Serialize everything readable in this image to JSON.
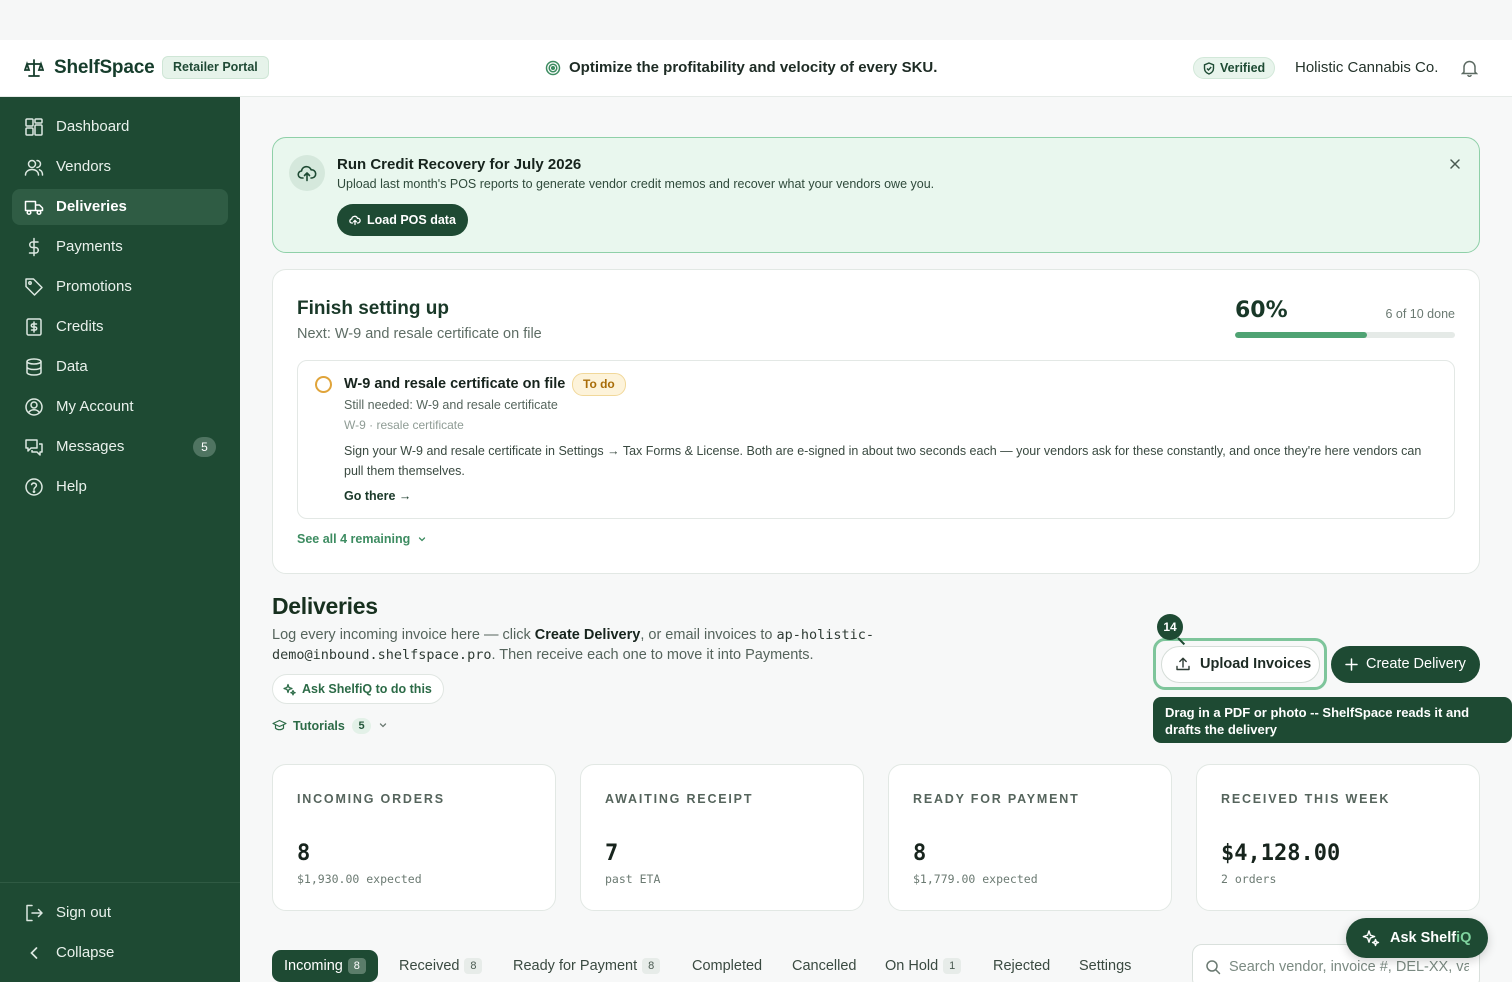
{
  "header": {
    "brand": "ShelfSpace",
    "portal_badge": "Retailer Portal",
    "tagline": "Optimize the profitability and velocity of every SKU.",
    "verified": "Verified",
    "company": "Holistic Cannabis Co."
  },
  "sidebar": {
    "items": [
      {
        "label": "Dashboard",
        "icon": "dashboard-icon"
      },
      {
        "label": "Vendors",
        "icon": "users-icon"
      },
      {
        "label": "Deliveries",
        "icon": "truck-icon",
        "active": true
      },
      {
        "label": "Payments",
        "icon": "dollar-icon"
      },
      {
        "label": "Promotions",
        "icon": "tag-icon"
      },
      {
        "label": "Credits",
        "icon": "receipt-icon"
      },
      {
        "label": "Data",
        "icon": "database-icon"
      },
      {
        "label": "My Account",
        "icon": "user-circle-icon"
      },
      {
        "label": "Messages",
        "icon": "messages-icon",
        "badge": "5"
      },
      {
        "label": "Help",
        "icon": "help-icon"
      }
    ],
    "sign_out": "Sign out",
    "collapse": "Collapse"
  },
  "promo": {
    "title": "Run Credit Recovery for July 2026",
    "subtitle": "Upload last month's POS reports to generate vendor credit memos and recover what your vendors owe you.",
    "button": "Load POS data"
  },
  "setup": {
    "title": "Finish setting up",
    "next": "Next: W-9 and resale certificate on file",
    "percent_label": "60%",
    "progress": 0.6,
    "count": "6 of 10 done",
    "task": {
      "title": "W-9 and resale certificate on file",
      "status": "To do",
      "needed": "Still needed: W-9 and resale certificate",
      "tags": "W-9 · resale certificate",
      "description": "Sign your W-9 and resale certificate in Settings → Tax Forms & License. Both are e-signed in about two seconds each — your vendors ask for these constantly, and once they're here vendors can pull them themselves.",
      "link": "Go there →"
    },
    "see_all": "See all 4 remaining"
  },
  "deliveries": {
    "title": "Deliveries",
    "desc_pre": "Log every incoming invoice here — click ",
    "desc_bold": "Create Delivery",
    "desc_mid": ", or email invoices to ",
    "desc_email": "ap-holistic-demo@inbound.shelfspace.pro",
    "desc_post": ". Then receive each one to move it into Payments.",
    "ask_button": "Ask ShelfiQ to do this",
    "tutorials_label": "Tutorials",
    "tutorials_count": "5",
    "step_number": "14",
    "upload_button": "Upload Invoices",
    "create_button": "Create Delivery",
    "tooltip": "Drag in a PDF or photo -- ShelfSpace reads it and drafts the delivery"
  },
  "stats": [
    {
      "label": "INCOMING ORDERS",
      "value": "8",
      "sub": "$1,930.00 expected"
    },
    {
      "label": "AWAITING RECEIPT",
      "value": "7",
      "sub": "past ETA"
    },
    {
      "label": "READY FOR PAYMENT",
      "value": "8",
      "sub": "$1,779.00 expected"
    },
    {
      "label": "RECEIVED THIS WEEK",
      "value": "$4,128.00",
      "sub": "2 orders"
    }
  ],
  "tabs": [
    {
      "label": "Incoming",
      "count": "8",
      "active": true
    },
    {
      "label": "Received",
      "count": "8"
    },
    {
      "label": "Ready for Payment",
      "count": "8"
    },
    {
      "label": "Completed"
    },
    {
      "label": "Cancelled"
    },
    {
      "label": "On Hold",
      "count": "1"
    },
    {
      "label": "Rejected"
    },
    {
      "label": "Settings"
    }
  ],
  "search": {
    "placeholder": "Search vendor, invoice #, DEL-XX, va"
  },
  "fab": {
    "label_pre": "Ask Shelf",
    "label_accent": "iQ"
  },
  "colors": {
    "brand_green": "#1e4a33",
    "accent_green": "#4fa373",
    "todo_amber": "#e0a43a"
  }
}
